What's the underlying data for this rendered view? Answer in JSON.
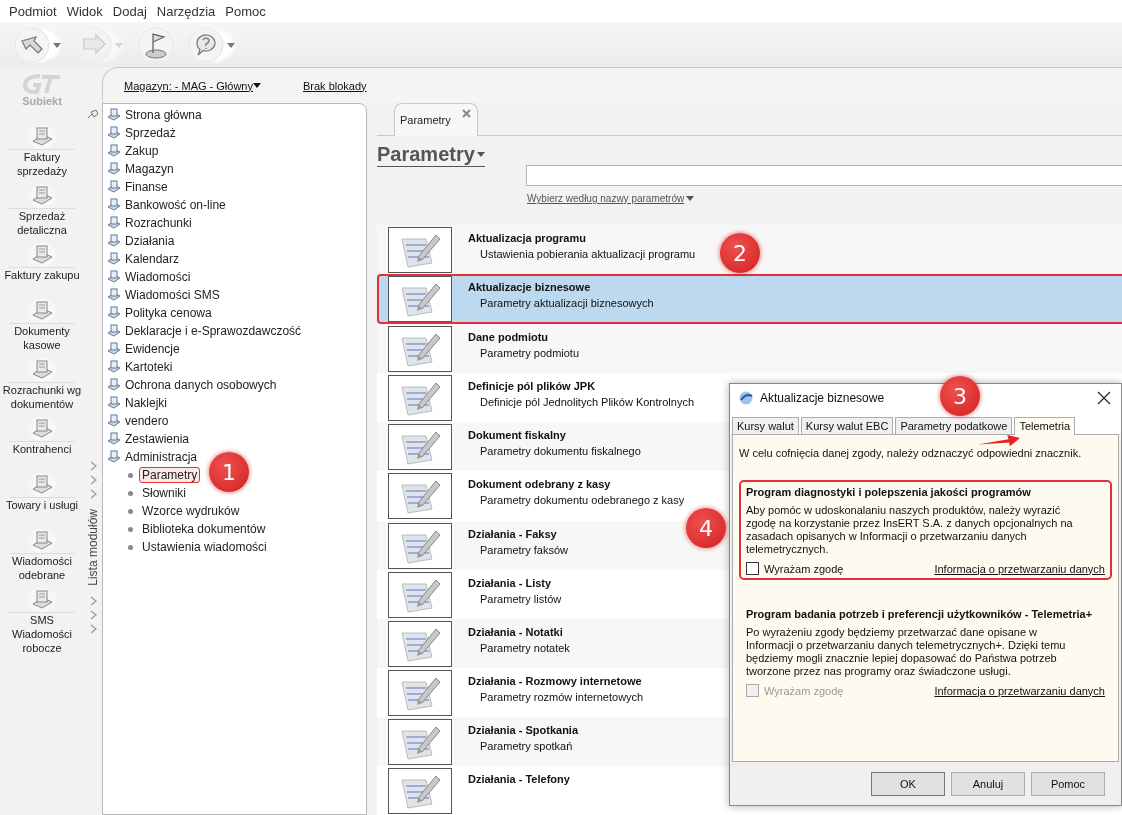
{
  "menu": [
    "Podmiot",
    "Widok",
    "Dodaj",
    "Narzędzia",
    "Pomoc"
  ],
  "toolbar": [
    {
      "kind": "back",
      "caret": true,
      "disabled": false
    },
    {
      "kind": "forward",
      "caret": true,
      "disabled": true
    },
    {
      "kind": "flag",
      "caret": false,
      "disabled": false
    },
    {
      "kind": "help",
      "caret": true,
      "disabled": false
    }
  ],
  "brand": "Subiekt",
  "launcher": [
    "Faktury\nsprzedaży",
    "Sprzedaż\ndetaliczna",
    "Faktury zakupu",
    "Dokumenty\nkasowe",
    "Rozrachunki wg\ndokumentów",
    "Kontrahenci",
    "Towary i usługi",
    "Wiadomości\nodebrane",
    "SMS\nWiadomości\nrobocze"
  ],
  "header": {
    "warehouse": "Magazyn: - MAG - Główny",
    "lock": "Brak blokady"
  },
  "modules": {
    "title": "Lista modułów",
    "items": [
      {
        "label": "Strona główna"
      },
      {
        "label": "Sprzedaż"
      },
      {
        "label": "Zakup"
      },
      {
        "label": "Magazyn"
      },
      {
        "label": "Finanse"
      },
      {
        "label": "Bankowość on-line"
      },
      {
        "label": "Rozrachunki"
      },
      {
        "label": "Działania"
      },
      {
        "label": "Kalendarz"
      },
      {
        "label": "Wiadomości"
      },
      {
        "label": "Wiadomości SMS"
      },
      {
        "label": "Polityka cenowa"
      },
      {
        "label": "Deklaracje i e-Sprawozdawczość"
      },
      {
        "label": "Ewidencje"
      },
      {
        "label": "Kartoteki"
      },
      {
        "label": "Ochrona danych osobowych"
      },
      {
        "label": "Naklejki"
      },
      {
        "label": "vendero"
      },
      {
        "label": "Zestawienia"
      },
      {
        "label": "Administracja",
        "children": [
          {
            "label": "Parametry",
            "selected": true
          },
          {
            "label": "Słowniki",
            "selected": false
          },
          {
            "label": "Wzorce wydruków",
            "selected": false
          },
          {
            "label": "Biblioteka dokumentów",
            "selected": false
          },
          {
            "label": "Ustawienia wiadomości",
            "selected": false
          }
        ]
      }
    ]
  },
  "tabs": [
    {
      "label": "Parametry",
      "selected": true
    }
  ],
  "page": {
    "title": "Parametry",
    "filter": "Wybierz według nazwy parametrów"
  },
  "parameters": [
    {
      "title": "Aktualizacja programu",
      "subtitle": "Ustawienia pobierania aktualizacji programu",
      "selected": false
    },
    {
      "title": "Aktualizacje biznesowe",
      "subtitle": "Parametry aktualizacji biznesowych",
      "selected": true
    },
    {
      "title": "Dane podmiotu",
      "subtitle": "Parametry podmiotu",
      "selected": false
    },
    {
      "title": "Definicje pól plików JPK",
      "subtitle": "Definicje pól Jednolitych Plików Kontrolnych",
      "selected": false
    },
    {
      "title": "Dokument fiskalny",
      "subtitle": "Parametry dokumentu fiskalnego",
      "selected": false
    },
    {
      "title": "Dokument odebrany z kasy",
      "subtitle": "Parametry dokumentu odebranego z kasy",
      "selected": false
    },
    {
      "title": "Działania - Faksy",
      "subtitle": "Parametry faksów",
      "selected": false
    },
    {
      "title": "Działania - Listy",
      "subtitle": "Parametry listów",
      "selected": false
    },
    {
      "title": "Działania - Notatki",
      "subtitle": "Parametry notatek",
      "selected": false
    },
    {
      "title": "Działania - Rozmowy internetowe",
      "subtitle": "Parametry rozmów internetowych",
      "selected": false
    },
    {
      "title": "Działania - Spotkania",
      "subtitle": "Parametry spotkań",
      "selected": false
    },
    {
      "title": "Działania - Telefony",
      "selected": false
    }
  ],
  "dialog": {
    "title": "Aktualizacje biznesowe",
    "tabs": [
      {
        "label": "Kursy walut",
        "selected": false
      },
      {
        "label": "Kursy walut EBC",
        "selected": false
      },
      {
        "label": "Parametry podatkowe",
        "selected": false
      },
      {
        "label": "Telemetria",
        "selected": true
      }
    ],
    "intro": "W celu cofnięcia danej zgody, należy odznaczyć odpowiedni znacznik.",
    "groups": [
      {
        "title": "Program diagnostyki i polepszenia jakości programów",
        "body": "Aby pomóc w udoskonalaniu naszych produktów, należy wyrazić zgodę na korzystanie przez InsERT S.A. z danych opcjonalnych na zasadach opisanych w Informacji o przetwarzaniu danych telemetrycznych.",
        "checkbox": {
          "label": "Wyrażam zgodę",
          "checked": false,
          "disabled": false
        },
        "link": "Informacja o przetwarzaniu danych",
        "highlighted": true
      },
      {
        "title": "Program badania potrzeb i preferencji użytkowników - Telemetria+",
        "body": "Po wyrażeniu zgody będziemy przetwarzać dane opisane w Informacji o przetwarzaniu danych telemetrycznych+. Dzięki temu będziemy mogli znacznie lepiej dopasować do Państwa potrzeb tworzone przez nas programy oraz świadczone usługi.",
        "checkbox": {
          "label": "Wyrażam zgodę",
          "checked": false,
          "disabled": true
        },
        "link": "Informacja o przetwarzaniu danych",
        "highlighted": false
      }
    ],
    "buttons": [
      "OK",
      "Anuluj",
      "Pomoc"
    ]
  },
  "callouts": [
    {
      "number": "1"
    },
    {
      "number": "2"
    },
    {
      "number": "3"
    },
    {
      "number": "4"
    }
  ]
}
